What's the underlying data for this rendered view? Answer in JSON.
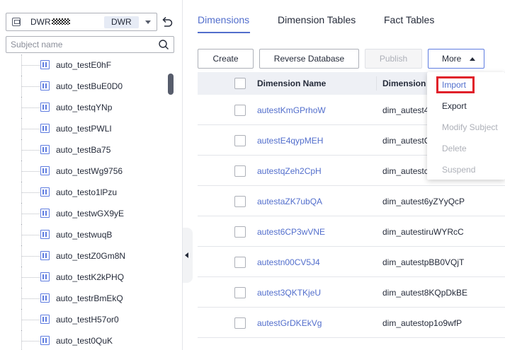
{
  "sidebar": {
    "workspace": {
      "name": "DWR",
      "tag": "DWR"
    },
    "search": {
      "placeholder": "Subject name"
    },
    "items": [
      {
        "label": "auto_testE0hF"
      },
      {
        "label": "auto_testBuE0D0"
      },
      {
        "label": "auto_testqYNp"
      },
      {
        "label": "auto_testPWLI"
      },
      {
        "label": "auto_testBa75"
      },
      {
        "label": "auto_testWg9756"
      },
      {
        "label": "auto_testo1lPzu"
      },
      {
        "label": "auto_testwGX9yE"
      },
      {
        "label": "auto_testwuqB"
      },
      {
        "label": "auto_testZ0Gm8N"
      },
      {
        "label": "auto_testK2kPHQ"
      },
      {
        "label": "auto_testrBmEkQ"
      },
      {
        "label": "auto_testH57or0"
      },
      {
        "label": "auto_test0QuK"
      }
    ]
  },
  "tabs": [
    {
      "label": "Dimensions",
      "active": true
    },
    {
      "label": "Dimension Tables",
      "active": false
    },
    {
      "label": "Fact Tables",
      "active": false
    }
  ],
  "toolbar": {
    "create": "Create",
    "reverse_database": "Reverse Database",
    "publish": "Publish",
    "more": "More"
  },
  "table": {
    "headers": {
      "name": "Dimension Name",
      "table": "Dimension"
    },
    "rows": [
      {
        "name": "autestKmGPrhoW",
        "table": "dim_autest4"
      },
      {
        "name": "autestE4qypMEH",
        "table": "dim_autestC"
      },
      {
        "name": "autestqZeh2CpH",
        "table": "dim_autestc"
      },
      {
        "name": "autestaZK7ubQA",
        "table": "dim_autest6yZYyQcP"
      },
      {
        "name": "autest6CP3wVNE",
        "table": "dim_autestiruWYRcC"
      },
      {
        "name": "autestn00CV5J4",
        "table": "dim_autestpBB0VQjT"
      },
      {
        "name": "autest3QKTKjeU",
        "table": "dim_autest8KQpDkBE"
      },
      {
        "name": "autestGrDKEkVg",
        "table": "dim_autestop1o9wfP"
      }
    ]
  },
  "more_menu": {
    "items": [
      {
        "label": "Import",
        "disabled": false
      },
      {
        "label": "Export",
        "disabled": false
      },
      {
        "label": "Modify Subject",
        "disabled": true
      },
      {
        "label": "Delete",
        "disabled": true
      },
      {
        "label": "Suspend",
        "disabled": true
      }
    ]
  },
  "colors": {
    "accent": "#526ecc",
    "highlight": "#e0202a"
  }
}
